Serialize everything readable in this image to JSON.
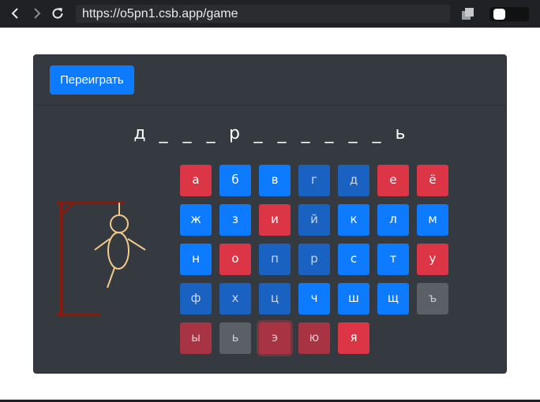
{
  "browser": {
    "url": "https://o5pn1.csb.app/game"
  },
  "game": {
    "replay_label": "Переиграть",
    "word_slots": [
      "д",
      "_",
      "_",
      "_",
      "р",
      "_",
      "_",
      "_",
      "_",
      "_",
      "_",
      "ь"
    ],
    "keyboard": [
      {
        "letter": "а",
        "state": "wrong"
      },
      {
        "letter": "б",
        "state": "available"
      },
      {
        "letter": "в",
        "state": "available"
      },
      {
        "letter": "г",
        "state": "available-dim"
      },
      {
        "letter": "д",
        "state": "available-dim"
      },
      {
        "letter": "е",
        "state": "wrong"
      },
      {
        "letter": "ё",
        "state": "wrong"
      },
      {
        "letter": "ж",
        "state": "available"
      },
      {
        "letter": "з",
        "state": "available"
      },
      {
        "letter": "и",
        "state": "wrong"
      },
      {
        "letter": "й",
        "state": "available-dim"
      },
      {
        "letter": "к",
        "state": "available"
      },
      {
        "letter": "л",
        "state": "available"
      },
      {
        "letter": "м",
        "state": "available"
      },
      {
        "letter": "н",
        "state": "available"
      },
      {
        "letter": "о",
        "state": "wrong"
      },
      {
        "letter": "п",
        "state": "available-dim"
      },
      {
        "letter": "р",
        "state": "available-dim"
      },
      {
        "letter": "с",
        "state": "available"
      },
      {
        "letter": "т",
        "state": "available"
      },
      {
        "letter": "у",
        "state": "wrong"
      },
      {
        "letter": "ф",
        "state": "available-dim"
      },
      {
        "letter": "х",
        "state": "available-dim"
      },
      {
        "letter": "ц",
        "state": "available-dim"
      },
      {
        "letter": "ч",
        "state": "available"
      },
      {
        "letter": "ш",
        "state": "available"
      },
      {
        "letter": "щ",
        "state": "available"
      },
      {
        "letter": "ъ",
        "state": "disabled"
      },
      {
        "letter": "ы",
        "state": "wrong-dim"
      },
      {
        "letter": "ь",
        "state": "disabled"
      },
      {
        "letter": "э",
        "state": "wrong-dim-focus"
      },
      {
        "letter": "ю",
        "state": "wrong-dim"
      },
      {
        "letter": "я",
        "state": "wrong"
      }
    ]
  },
  "colors": {
    "card_bg": "#343a40",
    "primary": "#0d7bff",
    "danger": "#dc3545",
    "gallows": "#8b1a0e",
    "figure": "#f4c98a"
  },
  "icons": {
    "back": "arrow-left-icon",
    "forward": "arrow-right-icon",
    "reload": "reload-icon",
    "extension": "copy-icon"
  }
}
